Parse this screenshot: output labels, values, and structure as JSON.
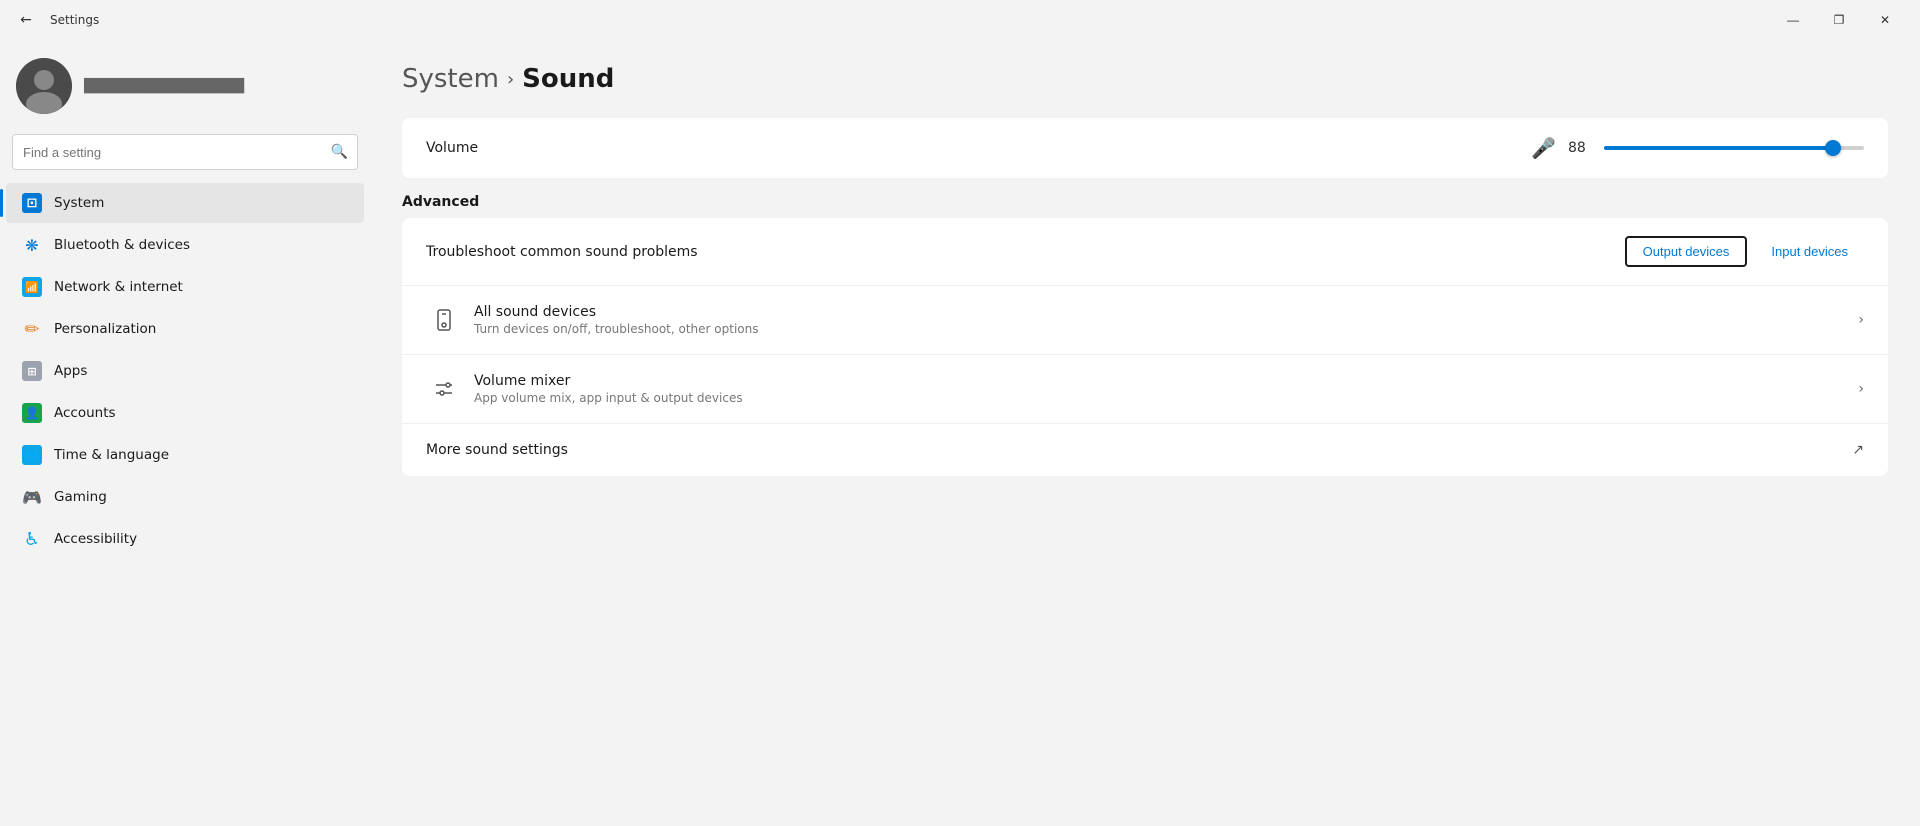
{
  "titlebar": {
    "title": "Settings",
    "minimize_label": "—",
    "maximize_label": "❐",
    "close_label": "✕"
  },
  "sidebar": {
    "search_placeholder": "Find a setting",
    "user_name": "████████████████",
    "nav_items": [
      {
        "id": "system",
        "label": "System",
        "active": true,
        "icon": "🖥"
      },
      {
        "id": "bluetooth",
        "label": "Bluetooth & devices",
        "active": false,
        "icon": "⬡"
      },
      {
        "id": "network",
        "label": "Network & internet",
        "active": false,
        "icon": "📶"
      },
      {
        "id": "personalization",
        "label": "Personalization",
        "active": false,
        "icon": "✏"
      },
      {
        "id": "apps",
        "label": "Apps",
        "active": false,
        "icon": "⊞"
      },
      {
        "id": "accounts",
        "label": "Accounts",
        "active": false,
        "icon": "👤"
      },
      {
        "id": "time",
        "label": "Time & language",
        "active": false,
        "icon": "🌐"
      },
      {
        "id": "gaming",
        "label": "Gaming",
        "active": false,
        "icon": "🎮"
      },
      {
        "id": "accessibility",
        "label": "Accessibility",
        "active": false,
        "icon": "♿"
      }
    ]
  },
  "content": {
    "breadcrumb_parent": "System",
    "breadcrumb_current": "Sound",
    "volume_label": "Volume",
    "volume_value": "88",
    "volume_percent": 88,
    "advanced_label": "Advanced",
    "troubleshoot_label": "Troubleshoot common sound problems",
    "output_devices_label": "Output devices",
    "input_devices_label": "Input devices",
    "all_devices_title": "All sound devices",
    "all_devices_desc": "Turn devices on/off, troubleshoot, other options",
    "volume_mixer_title": "Volume mixer",
    "volume_mixer_desc": "App volume mix, app input & output devices",
    "more_sound_settings_label": "More sound settings"
  }
}
